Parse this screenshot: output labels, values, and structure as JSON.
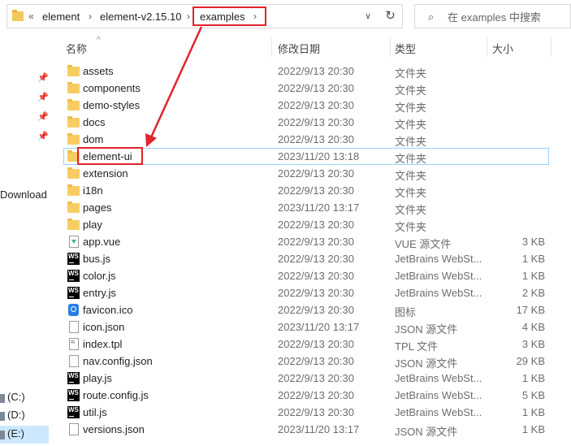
{
  "address": {
    "history_glyph": "«",
    "crumbs": [
      "element",
      "element-v2.15.10",
      "examples"
    ],
    "dropdown_glyph": "∨",
    "refresh_glyph": "↻"
  },
  "search": {
    "placeholder": "在 examples 中搜索"
  },
  "nav": {
    "download_label": "Download",
    "drives": [
      "(C:)",
      "(D:)",
      "(E:)"
    ]
  },
  "columns": {
    "name": "名称",
    "date": "修改日期",
    "type": "类型",
    "size": "大小"
  },
  "files": [
    {
      "name": "assets",
      "date": "2022/9/13 20:30",
      "type": "文件夹",
      "size": "",
      "icon": "folder-icon"
    },
    {
      "name": "components",
      "date": "2022/9/13 20:30",
      "type": "文件夹",
      "size": "",
      "icon": "folder-icon"
    },
    {
      "name": "demo-styles",
      "date": "2022/9/13 20:30",
      "type": "文件夹",
      "size": "",
      "icon": "folder-icon"
    },
    {
      "name": "docs",
      "date": "2022/9/13 20:30",
      "type": "文件夹",
      "size": "",
      "icon": "folder-icon"
    },
    {
      "name": "dom",
      "date": "2022/9/13 20:30",
      "type": "文件夹",
      "size": "",
      "icon": "folder-icon"
    },
    {
      "name": "element-ui",
      "date": "2023/11/20 13:18",
      "type": "文件夹",
      "size": "",
      "icon": "folder-icon"
    },
    {
      "name": "extension",
      "date": "2022/9/13 20:30",
      "type": "文件夹",
      "size": "",
      "icon": "folder-icon"
    },
    {
      "name": "i18n",
      "date": "2022/9/13 20:30",
      "type": "文件夹",
      "size": "",
      "icon": "folder-icon"
    },
    {
      "name": "pages",
      "date": "2023/11/20 13:17",
      "type": "文件夹",
      "size": "",
      "icon": "folder-icon"
    },
    {
      "name": "play",
      "date": "2022/9/13 20:30",
      "type": "文件夹",
      "size": "",
      "icon": "folder-icon"
    },
    {
      "name": "app.vue",
      "date": "2022/9/13 20:30",
      "type": "VUE 源文件",
      "size": "3 KB",
      "icon": "vue-file-icon"
    },
    {
      "name": "bus.js",
      "date": "2022/9/13 20:30",
      "type": "JetBrains WebSt...",
      "size": "1 KB",
      "icon": "webstorm-icon"
    },
    {
      "name": "color.js",
      "date": "2022/9/13 20:30",
      "type": "JetBrains WebSt...",
      "size": "1 KB",
      "icon": "webstorm-icon"
    },
    {
      "name": "entry.js",
      "date": "2022/9/13 20:30",
      "type": "JetBrains WebSt...",
      "size": "2 KB",
      "icon": "webstorm-icon"
    },
    {
      "name": "favicon.ico",
      "date": "2022/9/13 20:30",
      "type": "图标",
      "size": "17 KB",
      "icon": "favicon-icon"
    },
    {
      "name": "icon.json",
      "date": "2023/11/20 13:17",
      "type": "JSON 源文件",
      "size": "4 KB",
      "icon": "json-file-icon"
    },
    {
      "name": "index.tpl",
      "date": "2022/9/13 20:30",
      "type": "TPL 文件",
      "size": "3 KB",
      "icon": "tpl-file-icon"
    },
    {
      "name": "nav.config.json",
      "date": "2022/9/13 20:30",
      "type": "JSON 源文件",
      "size": "29 KB",
      "icon": "json-file-icon"
    },
    {
      "name": "play.js",
      "date": "2022/9/13 20:30",
      "type": "JetBrains WebSt...",
      "size": "1 KB",
      "icon": "webstorm-icon"
    },
    {
      "name": "route.config.js",
      "date": "2022/9/13 20:30",
      "type": "JetBrains WebSt...",
      "size": "5 KB",
      "icon": "webstorm-icon"
    },
    {
      "name": "util.js",
      "date": "2022/9/13 20:30",
      "type": "JetBrains WebSt...",
      "size": "1 KB",
      "icon": "webstorm-icon"
    },
    {
      "name": "versions.json",
      "date": "2023/11/20 13:17",
      "type": "JSON 源文件",
      "size": "1 KB",
      "icon": "json-file-icon"
    }
  ],
  "selected_index": 5,
  "annotation_color": "#e0242b",
  "selection_color": "#99d1ff",
  "folder_color": "#f7cd62"
}
